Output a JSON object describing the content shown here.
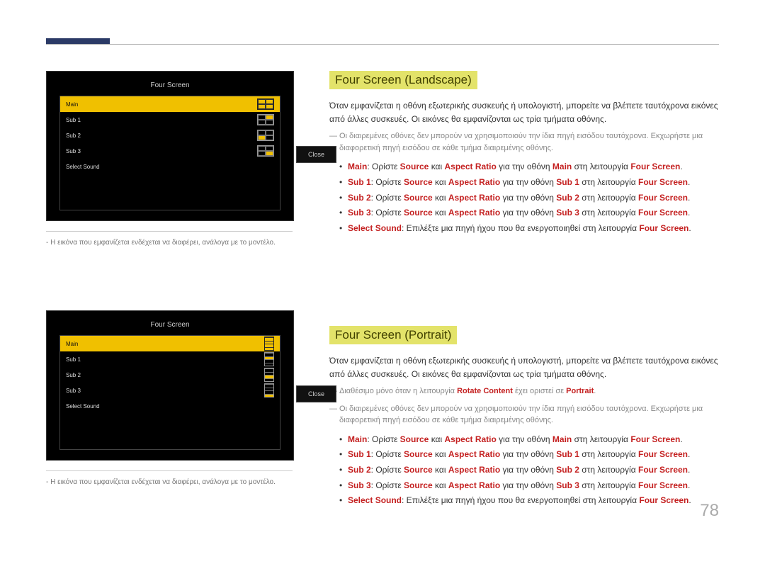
{
  "page_number": "78",
  "top": {
    "caption_note": "Η εικόνα που εμφανίζεται ενδέχεται να διαφέρει, ανάλογα με το μοντέλο."
  },
  "osd": {
    "title": "Four Screen",
    "rows": [
      "Main",
      "Sub 1",
      "Sub 2",
      "Sub 3",
      "Select Sound"
    ],
    "close": "Close"
  },
  "s1": {
    "heading": "Four Screen (Landscape)",
    "body": "Όταν εμφανίζεται η οθόνη εξωτερικής συσκευής ή υπολογιστή, μπορείτε να βλέπετε ταυτόχρονα εικόνες από άλλες συσκευές. Οι εικόνες θα εμφανίζονται ως τρία τμήματα οθόνης.",
    "note": "Οι διαιρεμένες οθόνες δεν μπορούν να χρησιμοποιούν την ίδια πηγή εισόδου ταυτόχρονα. Εκχωρήστε μια διαφορετική πηγή εισόδου σε κάθε τμήμα διαιρεμένης οθόνης.",
    "b1": {
      "k": "Main",
      "t": ": Ορίστε ",
      "src": "Source",
      " and": " και ",
      "ar": "Aspect Ratio",
      "mid": " για την οθόνη ",
      "k2": "Main",
      "mid2": " στη λειτουργία ",
      "fs": "Four Screen",
      "end": "."
    },
    "b2": {
      "k": "Sub 1",
      "k2": "Sub 1"
    },
    "b3": {
      "k": "Sub 2",
      "k2": "Sub 2"
    },
    "b4": {
      "k": "Sub 3",
      "k2": "Sub 3"
    },
    "b5": {
      "k": "Select Sound",
      "t": ": Επιλέξτε μια πηγή ήχου που θα ενεργοποιηθεί στη λειτουργία ",
      "fs": "Four Screen",
      "end": "."
    }
  },
  "s2": {
    "heading": "Four Screen (Portrait)",
    "body": "Όταν εμφανίζεται η οθόνη εξωτερικής συσκευής ή υπολογιστή, μπορείτε να βλέπετε ταυτόχρονα εικόνες από άλλες συσκευές. Οι εικόνες θα εμφανίζονται ως τρία τμήματα οθόνης.",
    "avail_pre": "Διαθέσιμο μόνο όταν η λειτουργία ",
    "avail_rc": "Rotate Content",
    "avail_mid": " έχει οριστεί σε ",
    "avail_p": "Portrait",
    "avail_end": ".",
    "note": "Οι διαιρεμένες οθόνες δεν μπορούν να χρησιμοποιούν την ίδια πηγή εισόδου ταυτόχρονα. Εκχωρήστε μια διαφορετική πηγή εισόδου σε κάθε τμήμα διαιρεμένης οθόνης."
  },
  "tmpl": {
    "t": ": Ορίστε ",
    "and": " και ",
    "ar": "Aspect Ratio",
    "mid": " για την οθόνη ",
    "mid2": " στη λειτουργία ",
    "fs": "Four Screen",
    "end": ".",
    "src": "Source"
  }
}
